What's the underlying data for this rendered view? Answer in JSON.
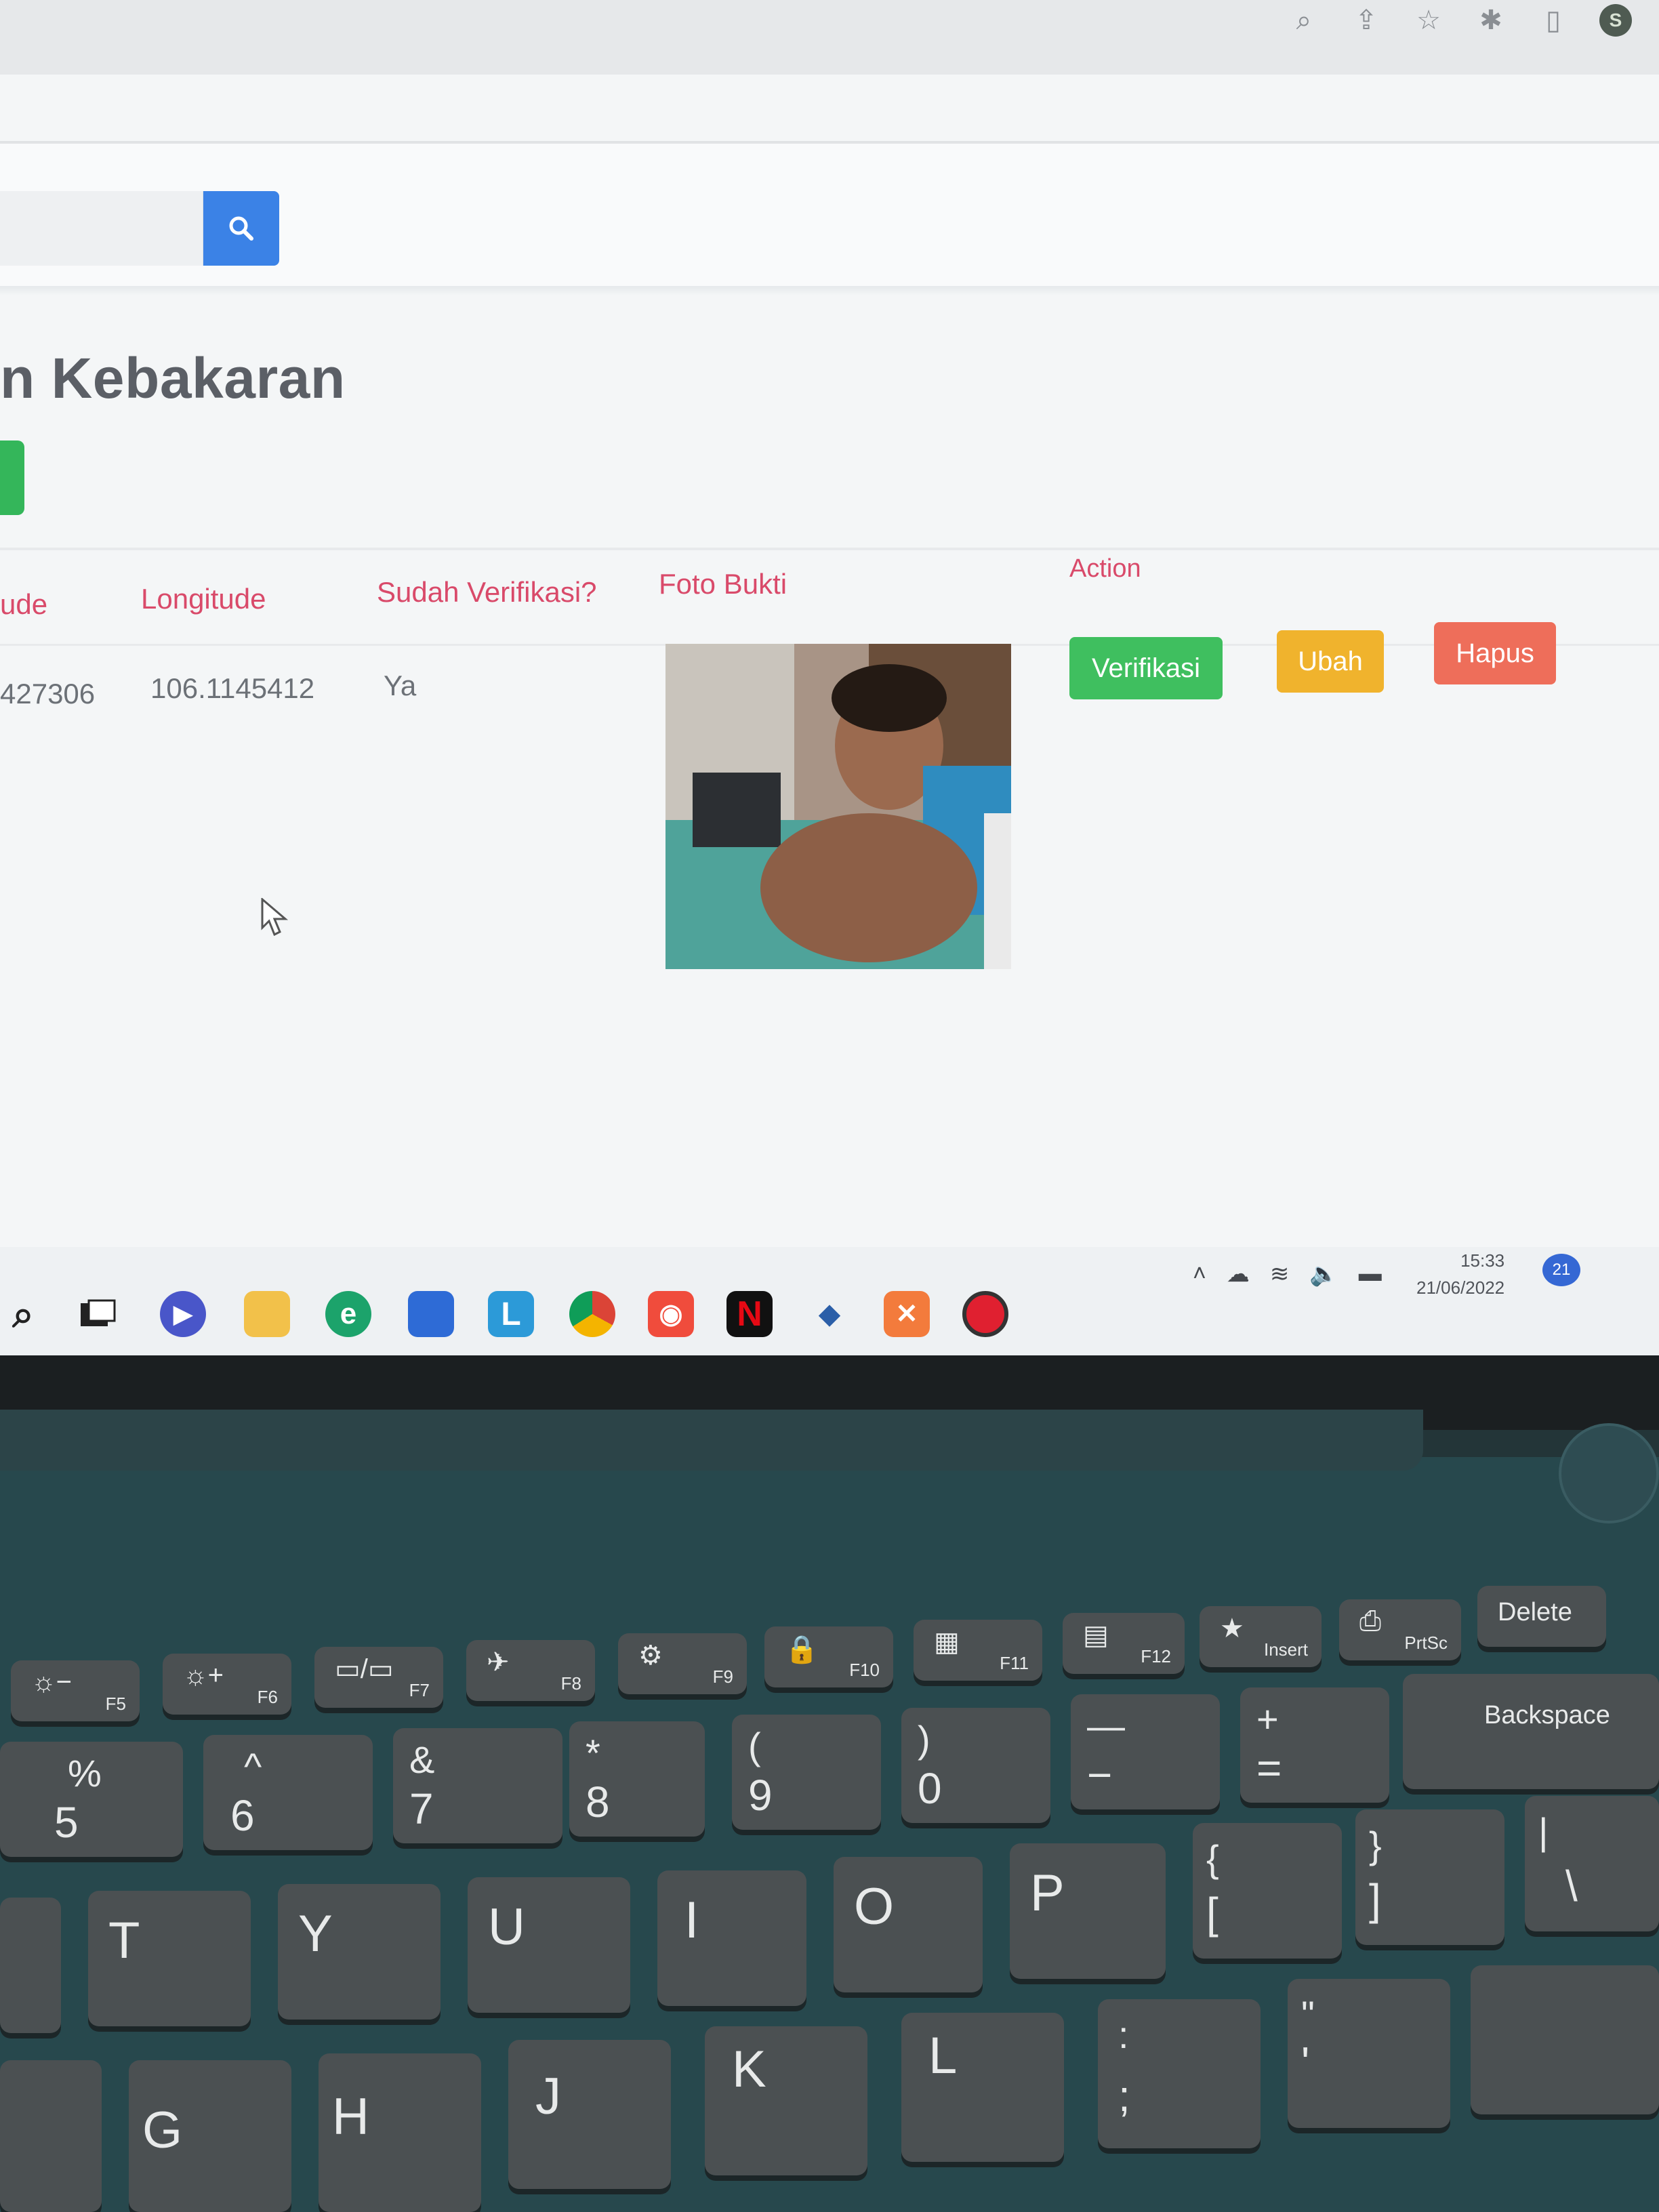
{
  "browser": {
    "toolbar_icons": [
      "zoom-icon",
      "share-icon",
      "bookmark-star-icon",
      "extensions-icon",
      "sidebar-icon",
      "profile-avatar"
    ],
    "profile_initial": "S"
  },
  "search": {
    "placeholder": ""
  },
  "page": {
    "title": "n Kebakaran"
  },
  "table": {
    "headers": [
      "ude",
      "Longitude",
      "Sudah Verifikasi?",
      "Foto Bukti",
      "Action"
    ],
    "rows": [
      {
        "latitude": "427306",
        "longitude": "106.1145412",
        "verified": "Ya",
        "actions": [
          "Verifikasi",
          "Ubah",
          "Hapus"
        ]
      }
    ]
  },
  "taskbar": {
    "apps": [
      "search-icon",
      "task-view-icon",
      "meet-icon",
      "file-explorer-icon",
      "edge-icon",
      "store-icon",
      "l-app-icon",
      "chrome-icon",
      "app-red-icon",
      "netflix-icon",
      "app-blue-icon",
      "xampp-icon",
      "record-icon"
    ],
    "netflix_label": "N",
    "l_app_label": "L",
    "clock_time": "15:33",
    "clock_date": "21/06/2022",
    "notification_count": "21"
  },
  "keyboard": {
    "function_row": [
      {
        "icon": "☼−",
        "label": "F5"
      },
      {
        "icon": "☼+",
        "label": "F6"
      },
      {
        "icon": "▭/▭",
        "label": "F7"
      },
      {
        "icon": "✈",
        "label": "F8"
      },
      {
        "icon": "⚙",
        "label": "F9"
      },
      {
        "icon": "🔒",
        "label": "F10"
      },
      {
        "icon": "▦",
        "label": "F11"
      },
      {
        "icon": "▤",
        "label": "F12"
      },
      {
        "icon": "★",
        "label": "Insert"
      },
      {
        "icon": "⎙",
        "label": "PrtSc"
      }
    ],
    "delete_label": "Delete",
    "number_row": [
      {
        "top": "%",
        "bottom": "5"
      },
      {
        "top": "^",
        "bottom": "6"
      },
      {
        "top": "&",
        "bottom": "7"
      },
      {
        "top": "*",
        "bottom": "8"
      },
      {
        "top": "(",
        "bottom": "9"
      },
      {
        "top": ")",
        "bottom": "0"
      },
      {
        "top": "—",
        "bottom": "−"
      },
      {
        "top": "+",
        "bottom": "="
      }
    ],
    "backspace_label": "Backspace",
    "letter_row_1": [
      "T",
      "Y",
      "U",
      "I",
      "O",
      "P"
    ],
    "bracket_keys": [
      {
        "top": "{",
        "bottom": "["
      },
      {
        "top": "}",
        "bottom": "]"
      },
      {
        "top": "|",
        "bottom": "\\"
      }
    ],
    "letter_row_2": [
      "G",
      "H",
      "J",
      "K",
      "L"
    ],
    "punct_keys": [
      {
        "top": ":",
        "bottom": ";"
      },
      {
        "top": "\"",
        "bottom": "'"
      }
    ]
  }
}
